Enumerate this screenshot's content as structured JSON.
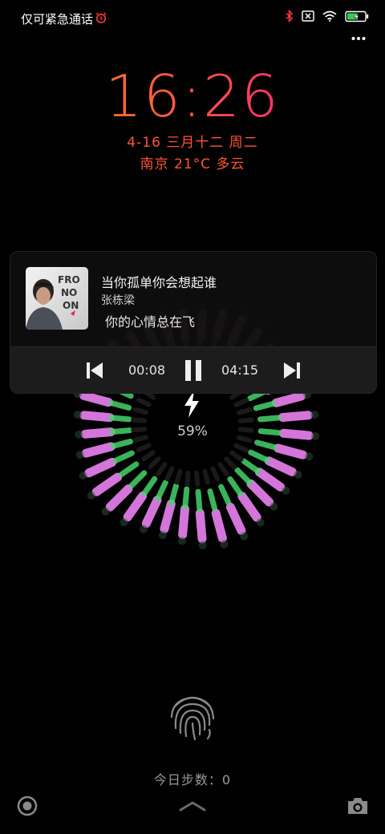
{
  "status_bar": {
    "carrier_text": "仅可紧急通话",
    "icons": [
      "alarm-icon",
      "bluetooth-icon",
      "no-sim-icon",
      "wifi-icon",
      "battery-charging-icon",
      "more-icon"
    ]
  },
  "clock": {
    "time": "16:26",
    "date": "4-16  三月十二  周二",
    "weather": "南京 21°C 多云"
  },
  "music": {
    "title": "当你孤单你会想起谁",
    "artist": "张栋梁",
    "lyric": "你的心情总在飞",
    "elapsed": "00:08",
    "duration": "04:15",
    "album_text": "FROM NOW ON"
  },
  "charging": {
    "percent_text": "59%",
    "percent": 59
  },
  "bottom": {
    "steps_text": "今日步数：0"
  },
  "colors": {
    "clock_gradient_start": "#ff8a1a",
    "clock_gradient_end": "#ff1f80",
    "date_color": "#ff5533",
    "ring_pink": "#e07ce6",
    "ring_green": "#46d36a"
  }
}
